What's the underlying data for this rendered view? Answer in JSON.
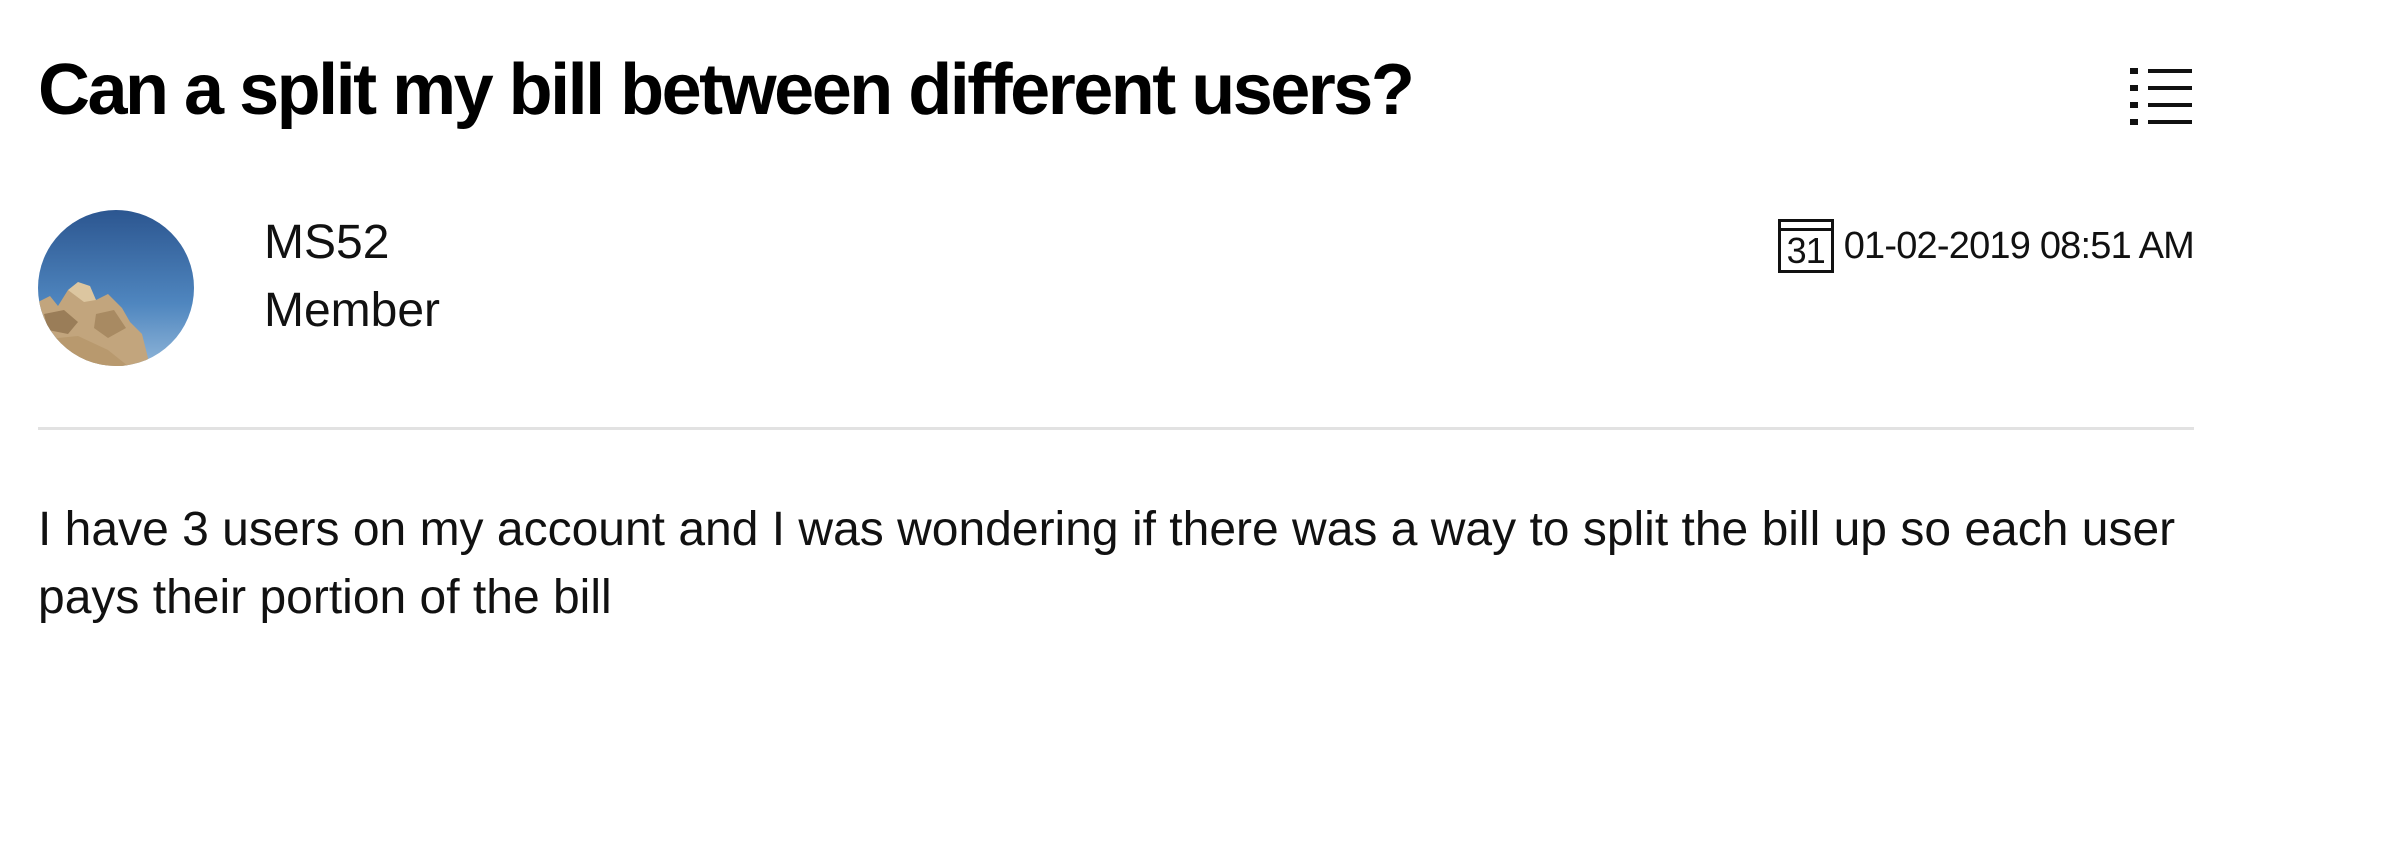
{
  "post": {
    "title": "Can a split my bill between different users?",
    "author": {
      "name": "MS52",
      "role": "Member"
    },
    "date": {
      "calendar_glyph": "31",
      "timestamp": "01-02-2019 08:51 AM"
    },
    "body": "I have 3 users on my account and I was wondering if there was a way to split the bill up so each user pays their portion of the bill",
    "options_icon": "list-icon"
  }
}
